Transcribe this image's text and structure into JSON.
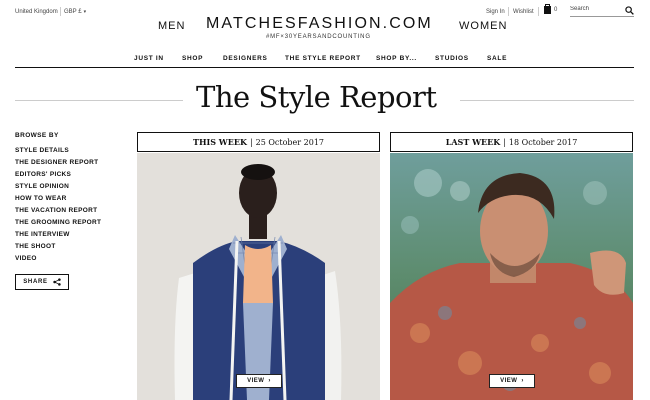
{
  "topbar": {
    "region": "United Kingdom",
    "currency": "GBP £",
    "currency_caret": "▾",
    "sign_in": "Sign In",
    "wishlist": "Wishlist",
    "bag_count": "0",
    "search_placeholder": "Search"
  },
  "header": {
    "men": "MEN",
    "women": "WOMEN",
    "logo": "MATCHESFASHION.COM",
    "tagline": "#MF×30YEARSANDCOUNTING"
  },
  "nav": {
    "items": [
      "JUST IN",
      "SHOP",
      "DESIGNERS",
      "THE STYLE REPORT",
      "SHOP BY...",
      "STUDIOS",
      "SALE"
    ]
  },
  "page": {
    "title": "The Style Report"
  },
  "sidebar": {
    "heading": "BROWSE BY",
    "items": [
      "STYLE DETAILS",
      "THE DESIGNER REPORT",
      "EDITORS' PICKS",
      "STYLE OPINION",
      "HOW TO WEAR",
      "THE VACATION REPORT",
      "THE GROOMING REPORT",
      "THE INTERVIEW",
      "THE SHOOT",
      "VIDEO"
    ],
    "share": "SHARE"
  },
  "cards": [
    {
      "label": "THIS WEEK",
      "date": "25 October 2017",
      "view": "VIEW",
      "view_arrow": "›"
    },
    {
      "label": "LAST WEEK",
      "date": "18 October 2017",
      "view": "VIEW",
      "view_arrow": "›"
    }
  ],
  "colors": {
    "text": "#111111",
    "rule": "#cccccc",
    "card1_bg": "#e5e3de",
    "cardigan_blue": "#2b3f7a",
    "card2_bg": "#5f8e88"
  }
}
